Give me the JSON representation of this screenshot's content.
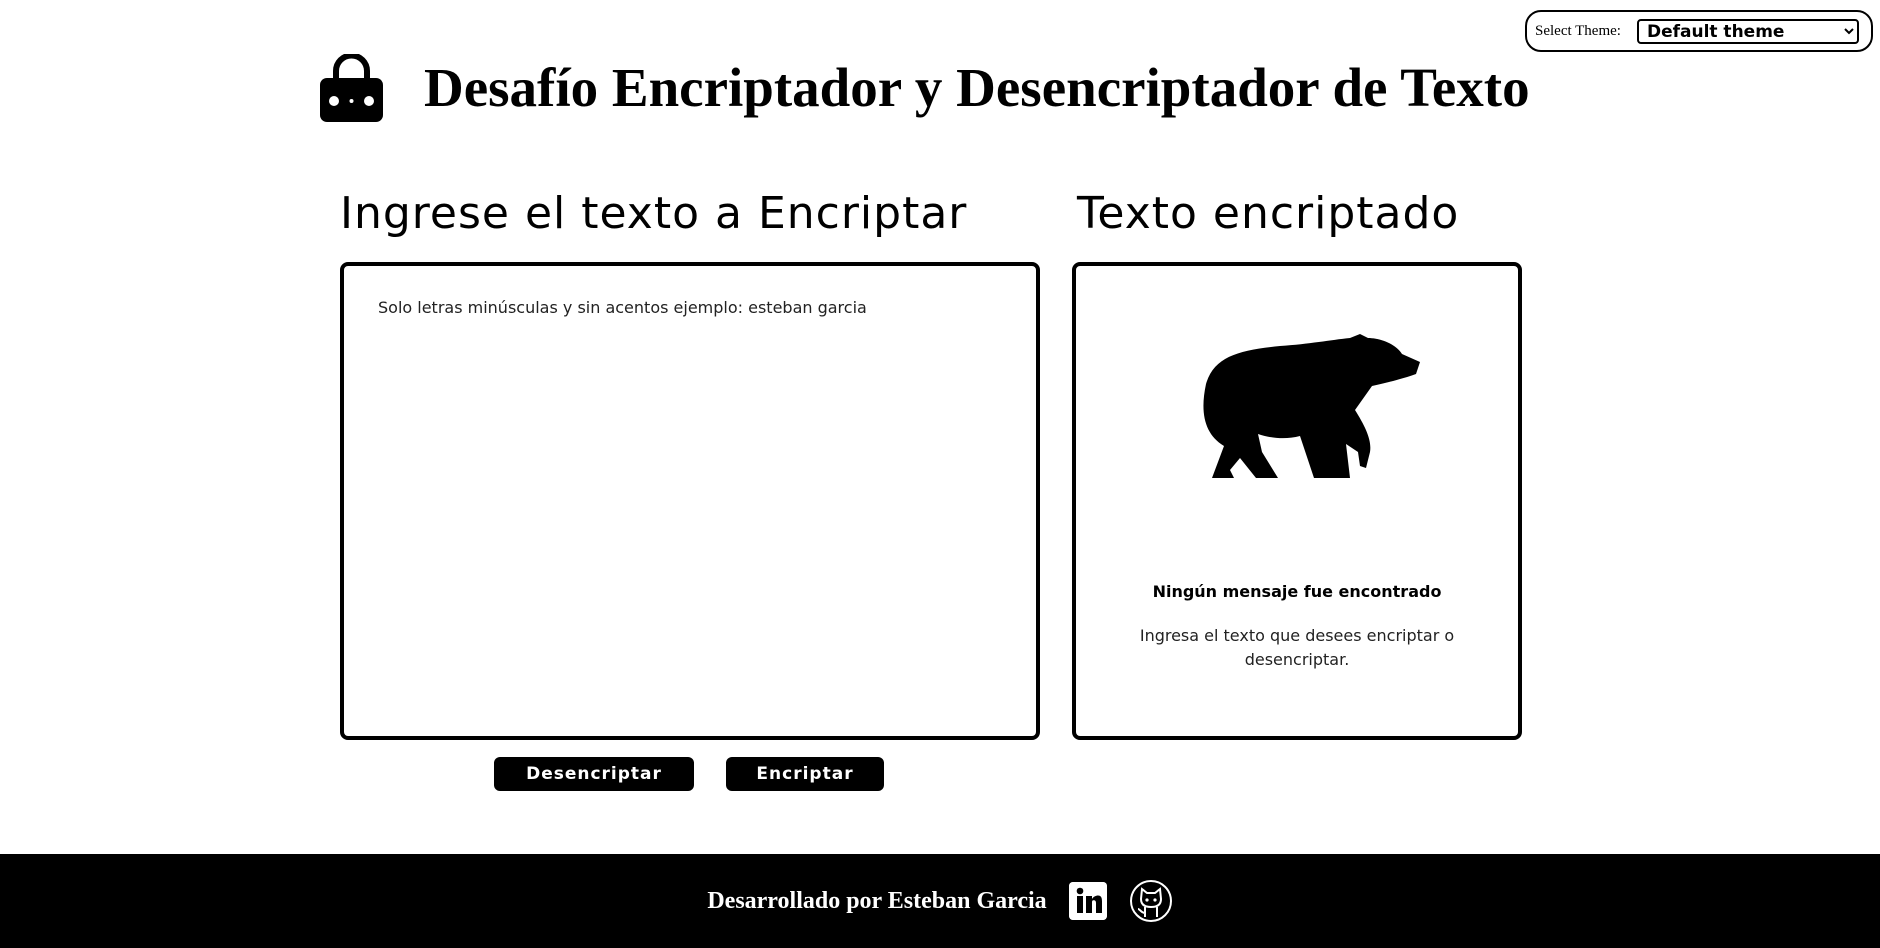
{
  "theme": {
    "label": "Select Theme:",
    "selected": "Default theme"
  },
  "header": {
    "title": "Desafío Encriptador y Desencriptador de Texto"
  },
  "input_panel": {
    "heading": "Ingrese el texto a Encriptar",
    "placeholder": "Solo letras minúsculas y sin acentos ejemplo: esteban garcia",
    "value": ""
  },
  "output_panel": {
    "heading": "Texto encriptado",
    "empty_title": "Ningún mensaje fue encontrado",
    "empty_text": "Ingresa el texto que desees encriptar o desencriptar."
  },
  "buttons": {
    "decrypt": "Desencriptar",
    "encrypt": "Encriptar"
  },
  "footer": {
    "text": "Desarrollado por Esteban Garcia"
  }
}
